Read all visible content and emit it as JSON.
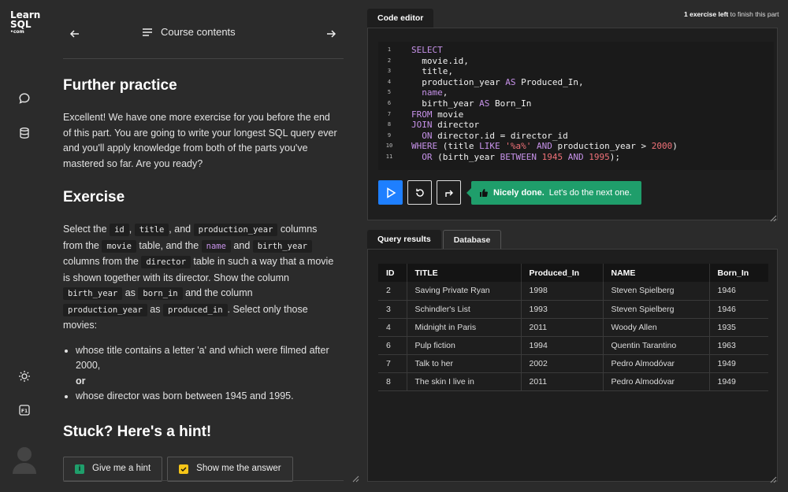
{
  "logo": {
    "line1": "Learn",
    "line2": "SQL",
    "line3": "•com"
  },
  "rail": {
    "icons": [
      "chat-icon",
      "database-icon",
      "theme-sun-icon",
      "f1-help-icon",
      "avatar"
    ]
  },
  "nav": {
    "title": "Course contents"
  },
  "lesson": {
    "further_heading": "Further practice",
    "intro": "Excellent! We have one more exercise for you before the end of this part. You are going to write your longest SQL query ever and you'll apply knowledge from both of the parts you've mastered so far. Are you ready?",
    "exercise_heading": "Exercise",
    "ex": {
      "t1": "Select the ",
      "c_id": "id",
      "t2": ", ",
      "c_title": "title",
      "t3": ", and ",
      "c_py": "production_year",
      "t4": " columns from the ",
      "c_movie": "movie",
      "t5": " table, and the ",
      "c_name": "name",
      "t6": " and ",
      "c_by": "birth_year",
      "t7": " columns from the ",
      "c_director": "director",
      "t8": " table in such a way that a movie is shown together with its director. Show the column ",
      "c_by2": "birth_year",
      "t9": " as ",
      "c_born": "born_in",
      "t10": " and the column ",
      "c_py2": "production_year",
      "t11": " as ",
      "c_prod": "produced_in",
      "t12": ". Select only those movies:"
    },
    "bullet1": "whose title contains a letter 'a' and which were filmed after 2000,",
    "or": "or",
    "bullet2": "whose director was born between 1945 and 1995.",
    "hint_heading": "Stuck? Here's a hint!",
    "hint_button": "Give me a hint",
    "answer_button": "Show me the answer"
  },
  "editor": {
    "tab": "Code editor",
    "exercise_left_bold": "1 exercise left",
    "exercise_left_rest": " to finish this part",
    "line_numbers": [
      "1",
      "2",
      "3",
      "4",
      "5",
      "6",
      "7",
      "8",
      "9",
      "10",
      "11"
    ],
    "toast_bold": "Nicely done.",
    "toast_rest": " Let's do the next one."
  },
  "results": {
    "tabs": [
      "Query results",
      "Database"
    ],
    "columns": [
      "ID",
      "TITLE",
      "Produced_In",
      "NAME",
      "Born_In"
    ],
    "rows": [
      [
        "2",
        "Saving Private Ryan",
        "1998",
        "Steven Spielberg",
        "1946"
      ],
      [
        "3",
        "Schindler's List",
        "1993",
        "Steven Spielberg",
        "1946"
      ],
      [
        "4",
        "Midnight in Paris",
        "2011",
        "Woody Allen",
        "1935"
      ],
      [
        "6",
        "Pulp fiction",
        "1994",
        "Quentin Tarantino",
        "1963"
      ],
      [
        "7",
        "Talk to her",
        "2002",
        "Pedro Almodóvar",
        "1949"
      ],
      [
        "8",
        "The skin I live in",
        "2011",
        "Pedro Almodóvar",
        "1949"
      ]
    ]
  },
  "colors": {
    "accent_blue": "#1e7fff",
    "success_green": "#1f9e6b",
    "keyword": "#c792ea",
    "literal": "#f07178"
  }
}
